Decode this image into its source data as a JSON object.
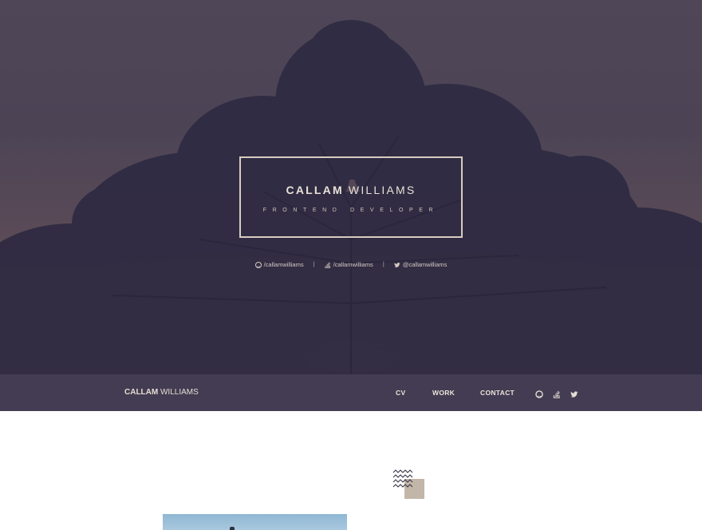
{
  "hero": {
    "first_name": "CALLAM",
    "last_name": " WILLIAMS",
    "subtitle": "FRONTEND DEVELOPER",
    "socials": [
      {
        "icon": "github-icon",
        "label": "/callamwilliams"
      },
      {
        "icon": "stackoverflow-icon",
        "label": "/callamwilliams"
      },
      {
        "icon": "twitter-icon",
        "label": "@callamwilliams"
      }
    ],
    "separator": "|"
  },
  "navbar": {
    "brand_first": "CALLAM",
    "brand_last": " WILLIAMS",
    "links": [
      "CV",
      "WORK",
      "CONTACT"
    ],
    "icons": [
      "github-icon",
      "stackoverflow-icon",
      "twitter-icon"
    ]
  },
  "colors": {
    "hero_overlay": "#4c4455",
    "navbar": "#433c52",
    "accent": "#bdb2a5",
    "text_light": "#e9e1d8"
  }
}
